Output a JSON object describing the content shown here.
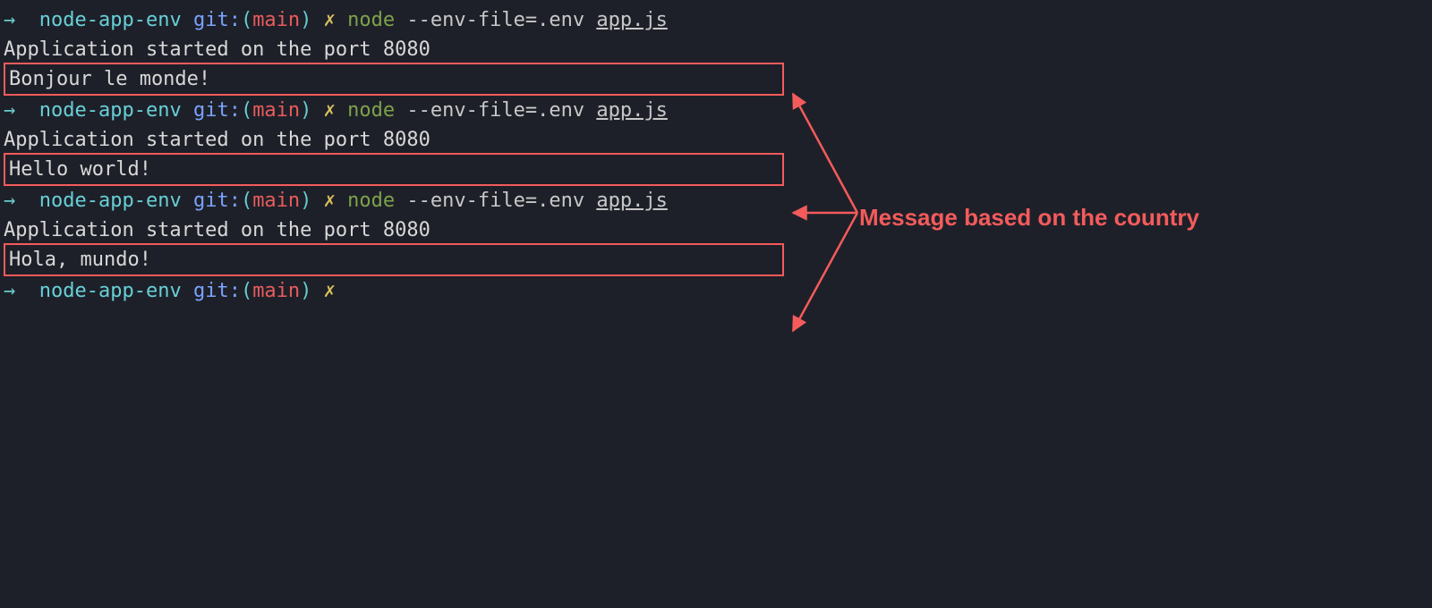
{
  "prompt": {
    "arrow": "→",
    "dir": "node-app-env",
    "git": "git:",
    "open_paren": "(",
    "branch": "main",
    "close_paren": ")",
    "dirty": "✗",
    "cmd": "node",
    "args": "--env-file=.env",
    "file": "app.js"
  },
  "runs": [
    {
      "started": "Application started on the port 8080",
      "message": "Bonjour le monde!"
    },
    {
      "started": "Application started on the port 8080",
      "message": "Hello world!"
    },
    {
      "started": "Application started on the port 8080",
      "message": "Hola, mundo!"
    }
  ],
  "annotation": "Message based on the country",
  "colors": {
    "bg": "#1e2029",
    "arrow": "#6cc",
    "dir": "#67d0d6",
    "git": "#7aa3ff",
    "branch": "#e85c5c",
    "dirty": "#d8c05b",
    "cmd": "#7ea24a",
    "highlight": "#f45b5b"
  }
}
